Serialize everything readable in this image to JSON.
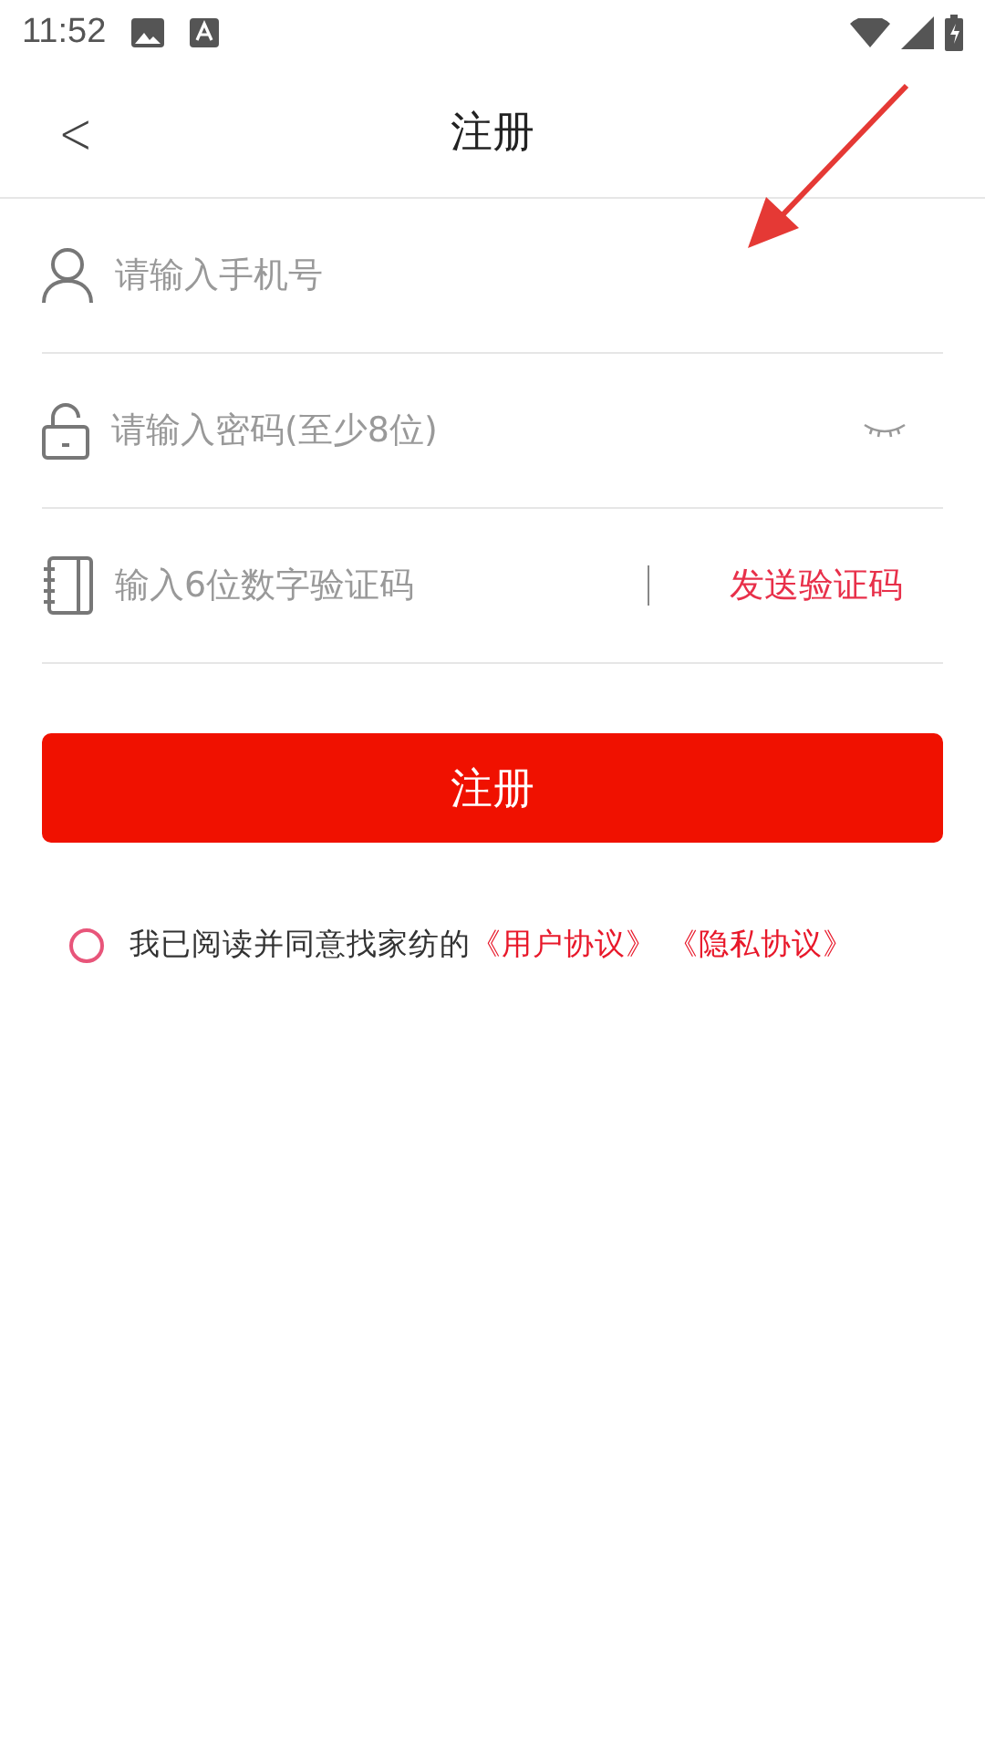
{
  "status_bar": {
    "time": "11:52"
  },
  "header": {
    "title": "注册",
    "back": "<"
  },
  "fields": [
    {
      "kind": "phone",
      "placeholder": "请输入手机号"
    },
    {
      "kind": "password",
      "placeholder": "请输入密码(至少8位)",
      "password_visible": false
    },
    {
      "kind": "code",
      "placeholder": "输入6位数字验证码",
      "action": "发送验证码"
    }
  ],
  "submit": "注册",
  "agreement": {
    "checked": false,
    "text": "我已阅读并同意找家纺的",
    "links": [
      "《用户协议》",
      "《隐私协议》"
    ]
  },
  "annotation": {
    "kind": "arrow"
  }
}
